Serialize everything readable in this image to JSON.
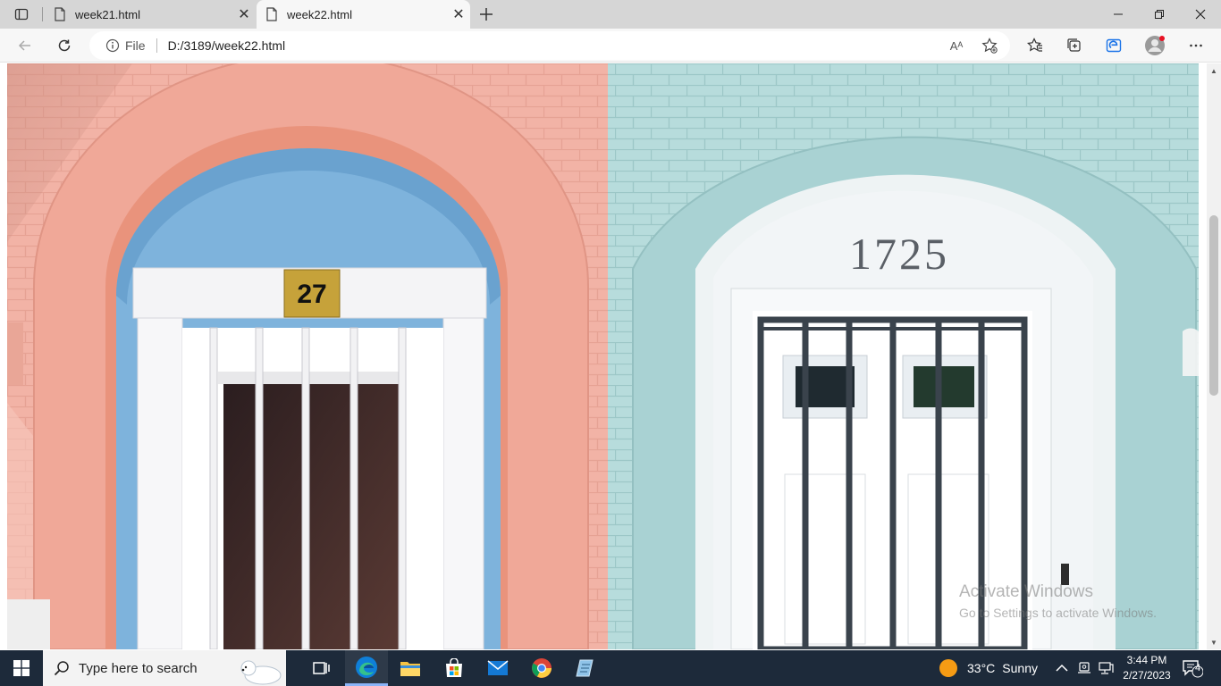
{
  "browser": {
    "tabs": [
      {
        "title": "week21.html",
        "active": false
      },
      {
        "title": "week22.html",
        "active": true
      }
    ],
    "address": {
      "scheme_label": "File",
      "url": "D:/3189/week22.html"
    },
    "read_aloud_label": "Aᴬ"
  },
  "page": {
    "house_numbers": {
      "left": "27",
      "right": "1725"
    },
    "colors": {
      "pink_wall": "#f2b3a6",
      "blue_wall": "#b7dcdc",
      "door_blue": "#7eb3dc"
    }
  },
  "watermark": {
    "line1": "Activate Windows",
    "line2": "Go to Settings to activate Windows."
  },
  "taskbar": {
    "search_placeholder": "Type here to search",
    "weather": {
      "temp": "33°C",
      "condition": "Sunny"
    },
    "clock": {
      "time": "3:44 PM",
      "date": "2/27/2023"
    },
    "notification_count": "4"
  }
}
